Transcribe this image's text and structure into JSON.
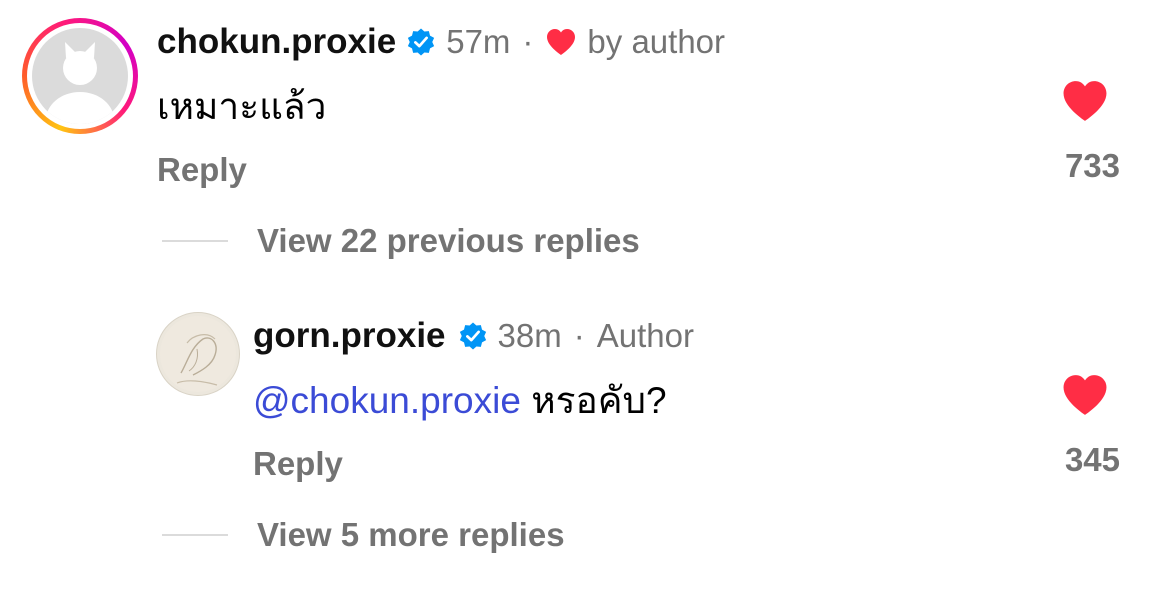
{
  "comment1": {
    "username": "chokun.proxie",
    "time": "57m",
    "separator": "·",
    "badge_label": "by author",
    "text": "เหมาะแล้ว",
    "reply_label": "Reply",
    "like_count": "733",
    "like_color": "#ff2d45",
    "verified_color": "#0095f6",
    "avatar_icon": "default-avatar-icon",
    "story_ring": [
      "#ff1a7a",
      "#ff5a2b",
      "#ffc412"
    ]
  },
  "view_previous": "View 22 previous replies",
  "comment2": {
    "username": "gorn.proxie",
    "time": "38m",
    "separator": "·",
    "badge_label": "Author",
    "mention": "@chokun.proxie",
    "text": " หรอคับ?",
    "reply_label": "Reply",
    "like_count": "345",
    "like_color": "#ff2d45",
    "verified_color": "#0095f6",
    "avatar_icon": "sketch-avatar-icon"
  },
  "view_more": "View 5 more replies"
}
